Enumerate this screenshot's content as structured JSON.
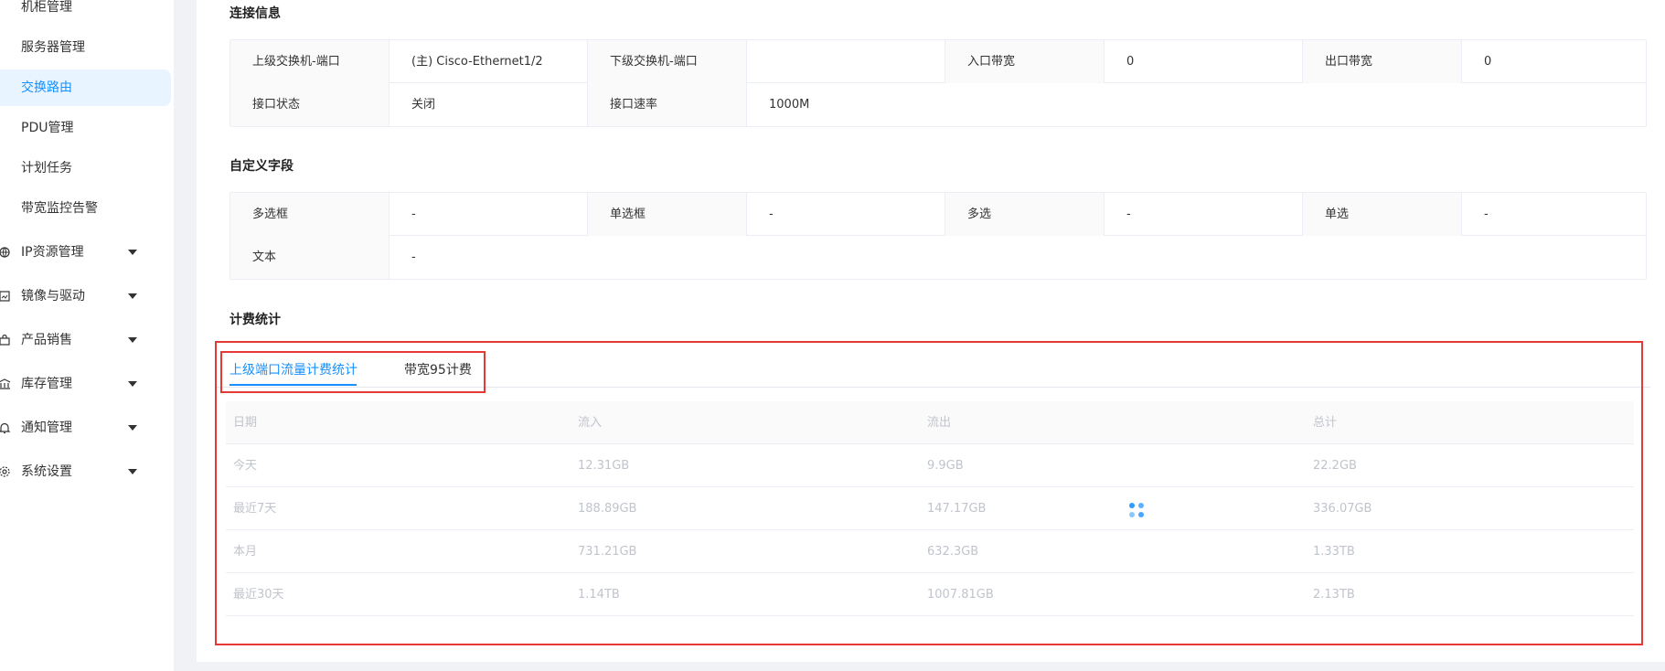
{
  "sidebar": {
    "sub_items": [
      "机柜管理",
      "服务器管理",
      "交换路由",
      "PDU管理",
      "计划任务",
      "带宽监控告警"
    ],
    "active_index": 2,
    "groups": [
      {
        "label": "IP资源管理",
        "icon": "network-icon"
      },
      {
        "label": "镜像与驱动",
        "icon": "image-icon"
      },
      {
        "label": "产品销售",
        "icon": "shopping-bag-icon"
      },
      {
        "label": "库存管理",
        "icon": "warehouse-icon"
      },
      {
        "label": "通知管理",
        "icon": "bell-icon"
      },
      {
        "label": "系统设置",
        "icon": "gear-icon"
      }
    ]
  },
  "connection": {
    "title": "连接信息",
    "upper_switch_port_label": "上级交换机-端口",
    "upper_switch_port_value": "(主) Cisco-Ethernet1/2",
    "lower_switch_port_label": "下级交换机-端口",
    "lower_switch_port_value": "",
    "inbound_bw_label": "入口带宽",
    "inbound_bw_value": "0",
    "outbound_bw_label": "出口带宽",
    "outbound_bw_value": "0",
    "port_status_label": "接口状态",
    "port_status_value": "关闭",
    "port_speed_label": "接口速率",
    "port_speed_value": "1000M"
  },
  "custom_fields": {
    "title": "自定义字段",
    "multi_checkbox_label": "多选框",
    "multi_checkbox_value": "-",
    "radio_label": "单选框",
    "radio_value": "-",
    "multi_select_label": "多选",
    "multi_select_value": "-",
    "single_select_label": "单选",
    "single_select_value": "-",
    "text_label": "文本",
    "text_value": "-"
  },
  "billing": {
    "title": "计费统计",
    "tabs": [
      "上级端口流量计费统计",
      "带宽95计费"
    ],
    "active_tab": 0,
    "table": {
      "headers": [
        "日期",
        "流入",
        "流出",
        "总计"
      ],
      "rows": [
        [
          "今天",
          "12.31GB",
          "9.9GB",
          "22.2GB"
        ],
        [
          "最近7天",
          "188.89GB",
          "147.17GB",
          "336.07GB"
        ],
        [
          "本月",
          "731.21GB",
          "632.3GB",
          "1.33TB"
        ],
        [
          "最近30天",
          "1.14TB",
          "1007.81GB",
          "2.13TB"
        ]
      ]
    }
  },
  "colors": {
    "accent": "#1890ff",
    "highlight": "#e53935"
  }
}
